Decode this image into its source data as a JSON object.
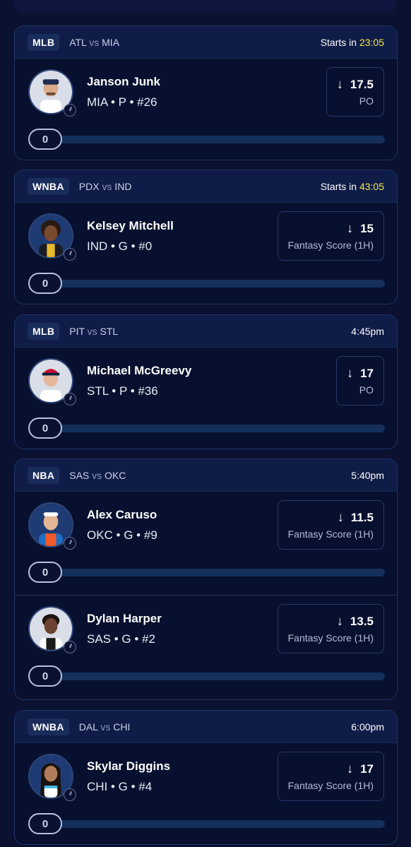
{
  "cards": [
    {
      "league": "MLB",
      "home": "ATL",
      "vs": "vs",
      "away": "MIA",
      "start_label": "Starts in",
      "countdown": "23:05",
      "time": "",
      "players": [
        {
          "name": "Janson Junk",
          "meta": "MIA • P • #26",
          "arrow": "↓",
          "line": "17.5",
          "stat": "PO",
          "progress": "0"
        }
      ]
    },
    {
      "league": "WNBA",
      "home": "PDX",
      "vs": "vs",
      "away": "IND",
      "start_label": "Starts in",
      "countdown": "43:05",
      "time": "",
      "players": [
        {
          "name": "Kelsey Mitchell",
          "meta": "IND • G • #0",
          "arrow": "↓",
          "line": "15",
          "stat": "Fantasy Score (1H)",
          "progress": "0"
        }
      ]
    },
    {
      "league": "MLB",
      "home": "PIT",
      "vs": "vs",
      "away": "STL",
      "start_label": "",
      "countdown": "",
      "time": "4:45pm",
      "players": [
        {
          "name": "Michael McGreevy",
          "meta": "STL • P • #36",
          "arrow": "↓",
          "line": "17",
          "stat": "PO",
          "progress": "0"
        }
      ]
    },
    {
      "league": "NBA",
      "home": "SAS",
      "vs": "vs",
      "away": "OKC",
      "start_label": "",
      "countdown": "",
      "time": "5:40pm",
      "players": [
        {
          "name": "Alex Caruso",
          "meta": "OKC • G • #9",
          "arrow": "↓",
          "line": "11.5",
          "stat": "Fantasy Score (1H)",
          "progress": "0"
        },
        {
          "name": "Dylan Harper",
          "meta": "SAS • G • #2",
          "arrow": "↓",
          "line": "13.5",
          "stat": "Fantasy Score (1H)",
          "progress": "0"
        }
      ]
    },
    {
      "league": "WNBA",
      "home": "DAL",
      "vs": "vs",
      "away": "CHI",
      "start_label": "",
      "countdown": "",
      "time": "6:00pm",
      "players": [
        {
          "name": "Skylar Diggins",
          "meta": "CHI • G • #4",
          "arrow": "↓",
          "line": "17",
          "stat": "Fantasy Score (1H)",
          "progress": "0"
        }
      ]
    }
  ],
  "colors": {
    "background": "#0b1130",
    "card": "#07102e",
    "card_header": "#0f1c47",
    "countdown": "#f2e84a",
    "progress_track": "#15305a"
  },
  "icons": {
    "arrow": "arrow-down-icon",
    "clock": "clock-icon"
  }
}
